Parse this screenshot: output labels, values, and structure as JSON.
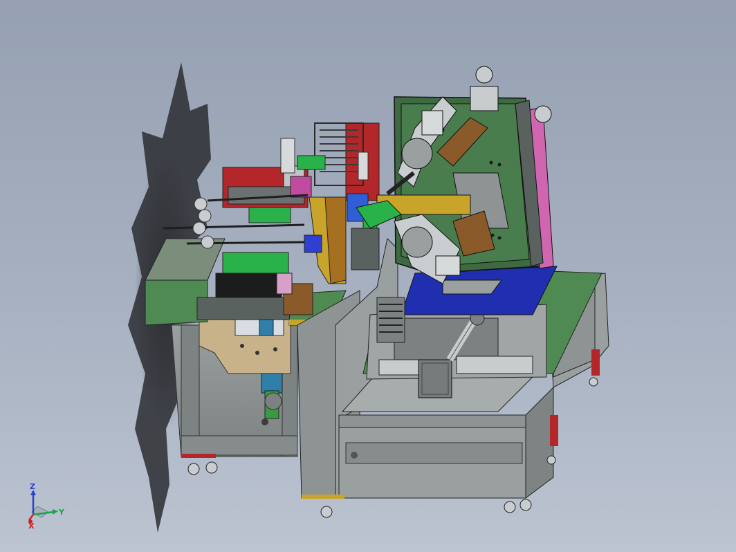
{
  "triad": {
    "x_label": "X",
    "y_label": "Y",
    "z_label": "Z"
  },
  "colors": {
    "background_top": "#95a0b2",
    "background_bottom": "#bcc4d1",
    "frame_gray": "#8e9493",
    "plate_green": "#4f8a52",
    "accent_red": "#b3262a",
    "accent_blue": "#1f2fb0",
    "accent_yellow": "#c8a42a",
    "panel_tan": "#c8b28a",
    "axis_x": "#d21f1f",
    "axis_y": "#18a54a",
    "axis_z": "#2a43c9"
  }
}
